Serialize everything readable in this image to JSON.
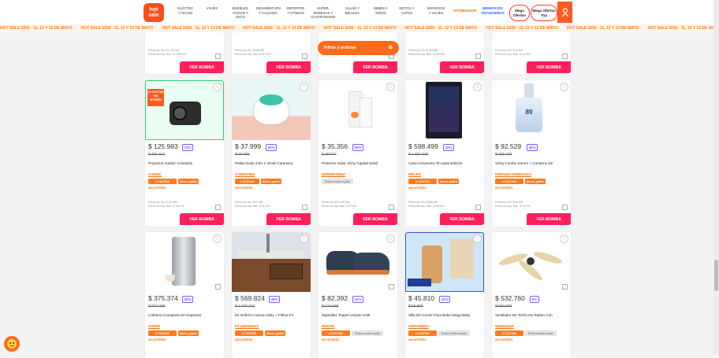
{
  "nav": {
    "logo": "hot sale",
    "items": [
      "ELECTRO Y TECNO",
      "VIAJES",
      "MUEBLES, HOGAR Y DECO",
      "INDUMENTARIA Y CALZADO",
      "DEPORTES Y FITNESS",
      "SUPER, BODEGAS Y GASTRONOMÍA",
      "SALUD Y BELLEZA",
      "BEBÉS Y NIÑOS",
      "MOTOS Y AUTOS",
      "SERVICIOS Y VIAJES",
      "OPTIMIZADOR",
      "BENEFICIOS FINANCIEROS"
    ],
    "mega_ofertas": "Mega Ofertas",
    "mega_ofertas_top": "Mega Ofertas Top"
  },
  "marquee": "HOT SALE 2026 · 11, 12 Y 13 DE MAYO ·",
  "filter_button": "Filtrar y ordenar",
  "top_row": [
    {
      "price_lines": "Precio por UD: $ 1.119.067\nPrecio sin Imp. Nac.: $ 1.099.113",
      "cta": "VER BOMBA"
    },
    {
      "price_lines": "Precio por UD: $ 948.462\nPrecio sin Imp. Nac.: $ 913.420",
      "cta": "VER BOMBA"
    },
    {
      "price_lines": "Precio por UD: $ 153.666\nPrecio sin Imp. Nac.: $ 130.063",
      "cta": "VER BOMBA"
    },
    {
      "price_lines": "Precio por UD: $ 153.666\nPrecio sin Imp. Nac.: $ 130.063",
      "cta": "VER BOMBA"
    },
    {
      "price_lines": "Precio por UD: $ 11.547\nPrecio sin Imp. Nac.: $ 11.050",
      "cta": "VER BOMBA"
    }
  ],
  "row1": [
    {
      "price": "$ 125.983",
      "pct": "74%",
      "old": "$ 491.544",
      "name": "Proyector Gadnic Conexión",
      "brand": "GADNIC",
      "tags": [
        "6 CUOTAS",
        "¡Envío gratis!"
      ],
      "note": "SIN INTERÉS",
      "lines": "Precio por UD: $ 125.983\nPrecio sin Imp. Nac.: $ 104.115",
      "cta": "VER BOMBA",
      "badge": "24 CUOTAS SIN INTERÉS"
    },
    {
      "price": "$ 37.999",
      "pct": "50%",
      "old": "$ 76.099",
      "name": "Pelela Daily 3 En 1 Verde Caramino",
      "brand": "CARESTINO",
      "tags": [
        "6 CUOTAS",
        "¡Envío gratis!"
      ],
      "note": "SIN INTERÉS",
      "lines": "Precio por UD: $ 37.999\nPrecio sin Imp. Nac.: $ 31.404",
      "cta": "VER BOMBA"
    },
    {
      "price": "$ 35.356",
      "pct": "55%",
      "old": "$ 78.571",
      "name": "Protector Solar Vichy Capital Soleil",
      "brand": "SUPERFARMA",
      "tags": [
        "Envío a todo el país"
      ],
      "note": "",
      "lines": "Precio por UD: $ 35.356\nPrecio sin Imp. Nac.: $ 29.220",
      "cta": "VER BOMBA"
    },
    {
      "price": "$ 598.499",
      "pct": "43%",
      "old": "$ 1.057.670",
      "name": "Cava Cervecera 78 Latas Edición",
      "brand": "INELRO",
      "tags": [
        "6 CUOTAS",
        "¡Envío gratis!"
      ],
      "note": "SIN INTERÉS",
      "lines": "Precio por UD: $ 598.499\nPrecio sin Imp. Nac.: $ 494.627",
      "cta": "VER BOMBA"
    },
    {
      "price": "$ 92.529",
      "pct": "45%",
      "old": "$ 168.236",
      "name": "Vichy Combo Serum + Contorno De",
      "brand": "PARAISO FARMACIAS",
      "tags": [
        "6 CUOTAS",
        "¡Envío gratis!"
      ],
      "note": "SIN INTERÉS",
      "lines": "Precio por UD: $ 92.529\nPrecio sin Imp. Nac.: $ 76.470",
      "cta": "VER BOMBA"
    }
  ],
  "row2": [
    {
      "price": "$ 375.374",
      "pct": "35%",
      "old": "$ 577.499",
      "name": "Cafetera Compacta De Espresso",
      "brand": "OSTER",
      "tags": [
        "6 CUOTAS",
        "¡Envío gratis!"
      ],
      "note": "SIN INTERÉS"
    },
    {
      "price": "$ 569.824",
      "pct": "45%",
      "old": "$ 1.036.044",
      "name": "Kit Grifería Cocina Libby + Filtros FV",
      "brand": "FV GRIFERIAS",
      "tags": [
        "6 CUOTAS",
        "¡Envío gratis!"
      ],
      "note": "SIN INTERÉS"
    },
    {
      "price": "$ 82.392",
      "pct": "34%",
      "old": "$ 123.899",
      "name": "Zapatillas Topper Umpier Kotk",
      "brand": "MOOVE",
      "tags": [
        "6 CUOTAS",
        "Envío a todo el país"
      ],
      "note": "SIN INTERÉS"
    },
    {
      "price": "$ 45.810",
      "pct": "10%",
      "old": "$ 50.900",
      "name": "Silla De Comer Para Bebé Mega Baby",
      "brand": "CRECIENDO",
      "tags": [
        "6 CUOTAS",
        "Envío a todo el país"
      ],
      "note": "SIN INTERÉS"
    },
    {
      "price": "$ 532.760",
      "pct": "5%",
      "old": "$ 560.800",
      "name": "Ventilador De Techo De Ratton Con",
      "brand": "WINHOUSE",
      "tags": [
        "6 CUOTAS",
        "Envío a todo el país"
      ],
      "note": "SIN INTERÉS"
    }
  ]
}
